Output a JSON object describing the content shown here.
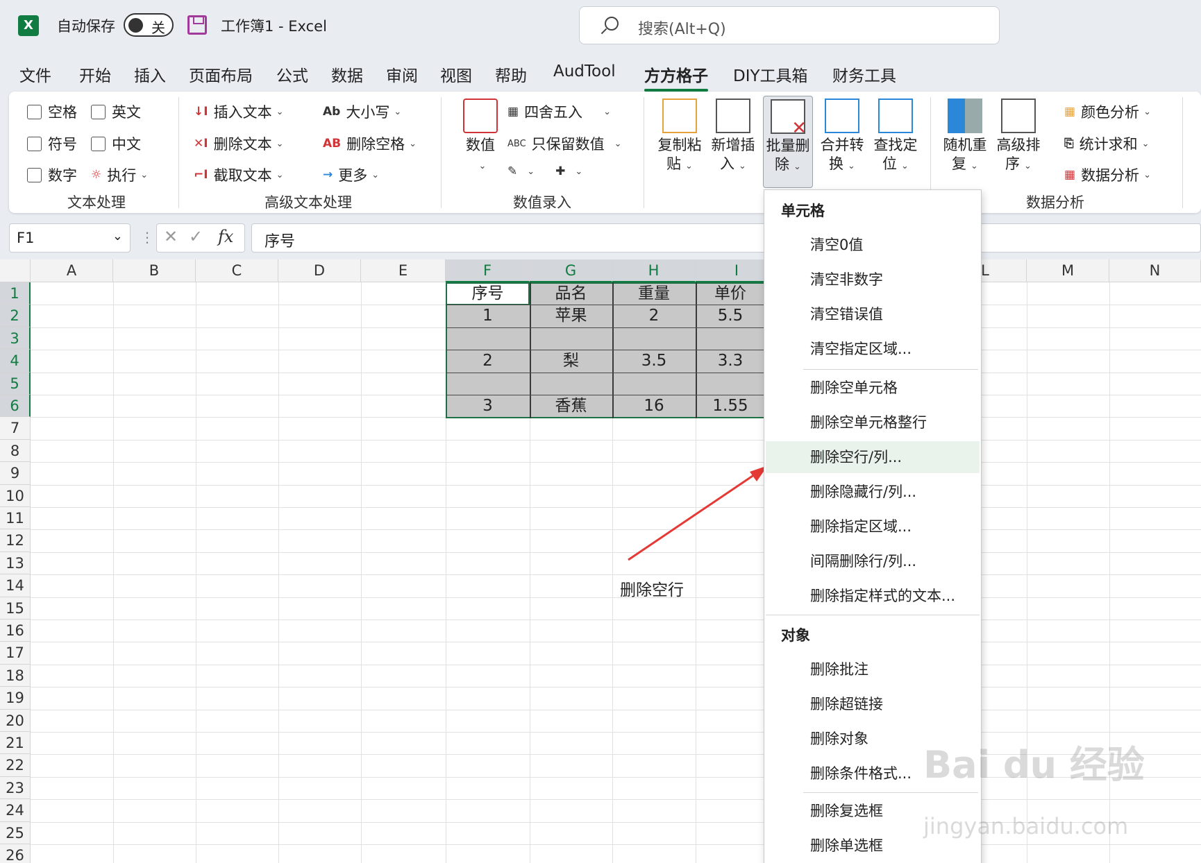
{
  "titlebar": {
    "autosave": "自动保存",
    "toggle": "关",
    "title": "工作簿1  -  Excel",
    "search": "搜索(Alt+Q)"
  },
  "menu": [
    "文件",
    "开始",
    "插入",
    "页面布局",
    "公式",
    "数据",
    "审阅",
    "视图",
    "帮助",
    "AudTool",
    "方方格子",
    "DIY工具箱",
    "财务工具"
  ],
  "ribbon": {
    "text": {
      "opts": [
        "空格",
        "英文",
        "符号",
        "中文",
        "数字"
      ],
      "exec": "执行",
      "label": "文本处理"
    },
    "adv": {
      "insert": "插入文本",
      "delete": "删除文本",
      "cut": "截取文本",
      "case": "大小写",
      "space": "删除空格",
      "more": "更多",
      "label": "高级文本处理",
      "ab": "Ab",
      "abc": "AB"
    },
    "num": {
      "value": "数值",
      "round": "四舍五入",
      "keep": "只保留数值",
      "label": "数值录入",
      "abc": "ABC"
    },
    "big": [
      {
        "l1": "复制粘",
        "l2": "贴"
      },
      {
        "l1": "新增插",
        "l2": "入"
      },
      {
        "l1": "批量删",
        "l2": "除"
      },
      {
        "l1": "合并转",
        "l2": "换"
      },
      {
        "l1": "查找定",
        "l2": "位"
      },
      {
        "l1": "随机重",
        "l2": "复"
      },
      {
        "l1": "高级排",
        "l2": "序"
      }
    ],
    "ana": {
      "color": "颜色分析",
      "sum": "统计求和",
      "data": "数据分析",
      "label": "数据分析"
    }
  },
  "formula": {
    "name": "F1",
    "value": "序号"
  },
  "sheet": {
    "columns": [
      "A",
      "B",
      "C",
      "D",
      "E",
      "F",
      "G",
      "H",
      "I",
      "",
      "",
      "L",
      "M",
      "N"
    ],
    "rows": [
      "1",
      "2",
      "3",
      "4",
      "5",
      "6",
      "7",
      "8",
      "9",
      "10",
      "11",
      "12",
      "13",
      "14",
      "15",
      "16",
      "17",
      "18",
      "19",
      "20",
      "21",
      "22",
      "23",
      "24",
      "25",
      "26"
    ],
    "table": [
      [
        "序号",
        "品名",
        "重量",
        "单价"
      ],
      [
        "1",
        "苹果",
        "2",
        "5.5"
      ],
      [
        "",
        "",
        "",
        ""
      ],
      [
        "2",
        "梨",
        "3.5",
        "3.3"
      ],
      [
        "",
        "",
        "",
        ""
      ],
      [
        "3",
        "香蕉",
        "16",
        "1.55"
      ]
    ]
  },
  "annotation": "删除空行",
  "dropdown": {
    "h1": "单元格",
    "g1": [
      "清空0值",
      "清空非数字",
      "清空错误值",
      "清空指定区域..."
    ],
    "g2": [
      "删除空单元格",
      "删除空单元格整行",
      "删除空行/列...",
      "删除隐藏行/列...",
      "删除指定区域...",
      "间隔删除行/列...",
      "删除指定样式的文本..."
    ],
    "h2": "对象",
    "g3": [
      "删除批注",
      "删除超链接",
      "删除对象",
      "删除条件格式..."
    ],
    "g4": [
      "删除复选框",
      "删除单选框"
    ]
  },
  "watermark": {
    "main": "Bai du 经验",
    "sub": "jingyan.baidu.com"
  },
  "colors": {
    "accent": "#107c41",
    "arrow": "#e53935"
  }
}
